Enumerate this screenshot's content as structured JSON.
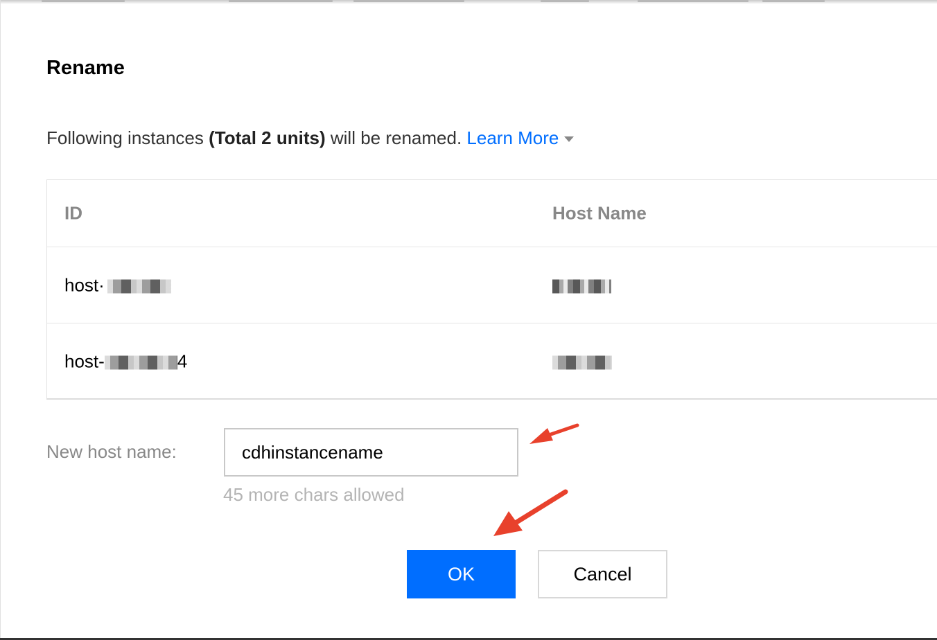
{
  "dialog": {
    "title": "Rename",
    "intro": {
      "prefix": "Following instances ",
      "total": "(Total 2 units)",
      "suffix": " will be renamed. ",
      "learn_more": "Learn More"
    },
    "table": {
      "headers": [
        "ID",
        "Host Name"
      ],
      "rows": [
        {
          "id_prefix": "host·"
        },
        {
          "id_prefix": "host-",
          "id_suffix": "4"
        }
      ]
    },
    "form": {
      "label": "New host name:",
      "value": "cdhinstancename",
      "hint": "45 more chars allowed"
    },
    "buttons": {
      "ok": "OK",
      "cancel": "Cancel"
    }
  },
  "colors": {
    "primary": "#006eff",
    "annotation_arrow": "#e8412c"
  },
  "icons": {
    "learn_more_caret": "caret-down-icon",
    "annotation": "red-arrow-icon"
  }
}
